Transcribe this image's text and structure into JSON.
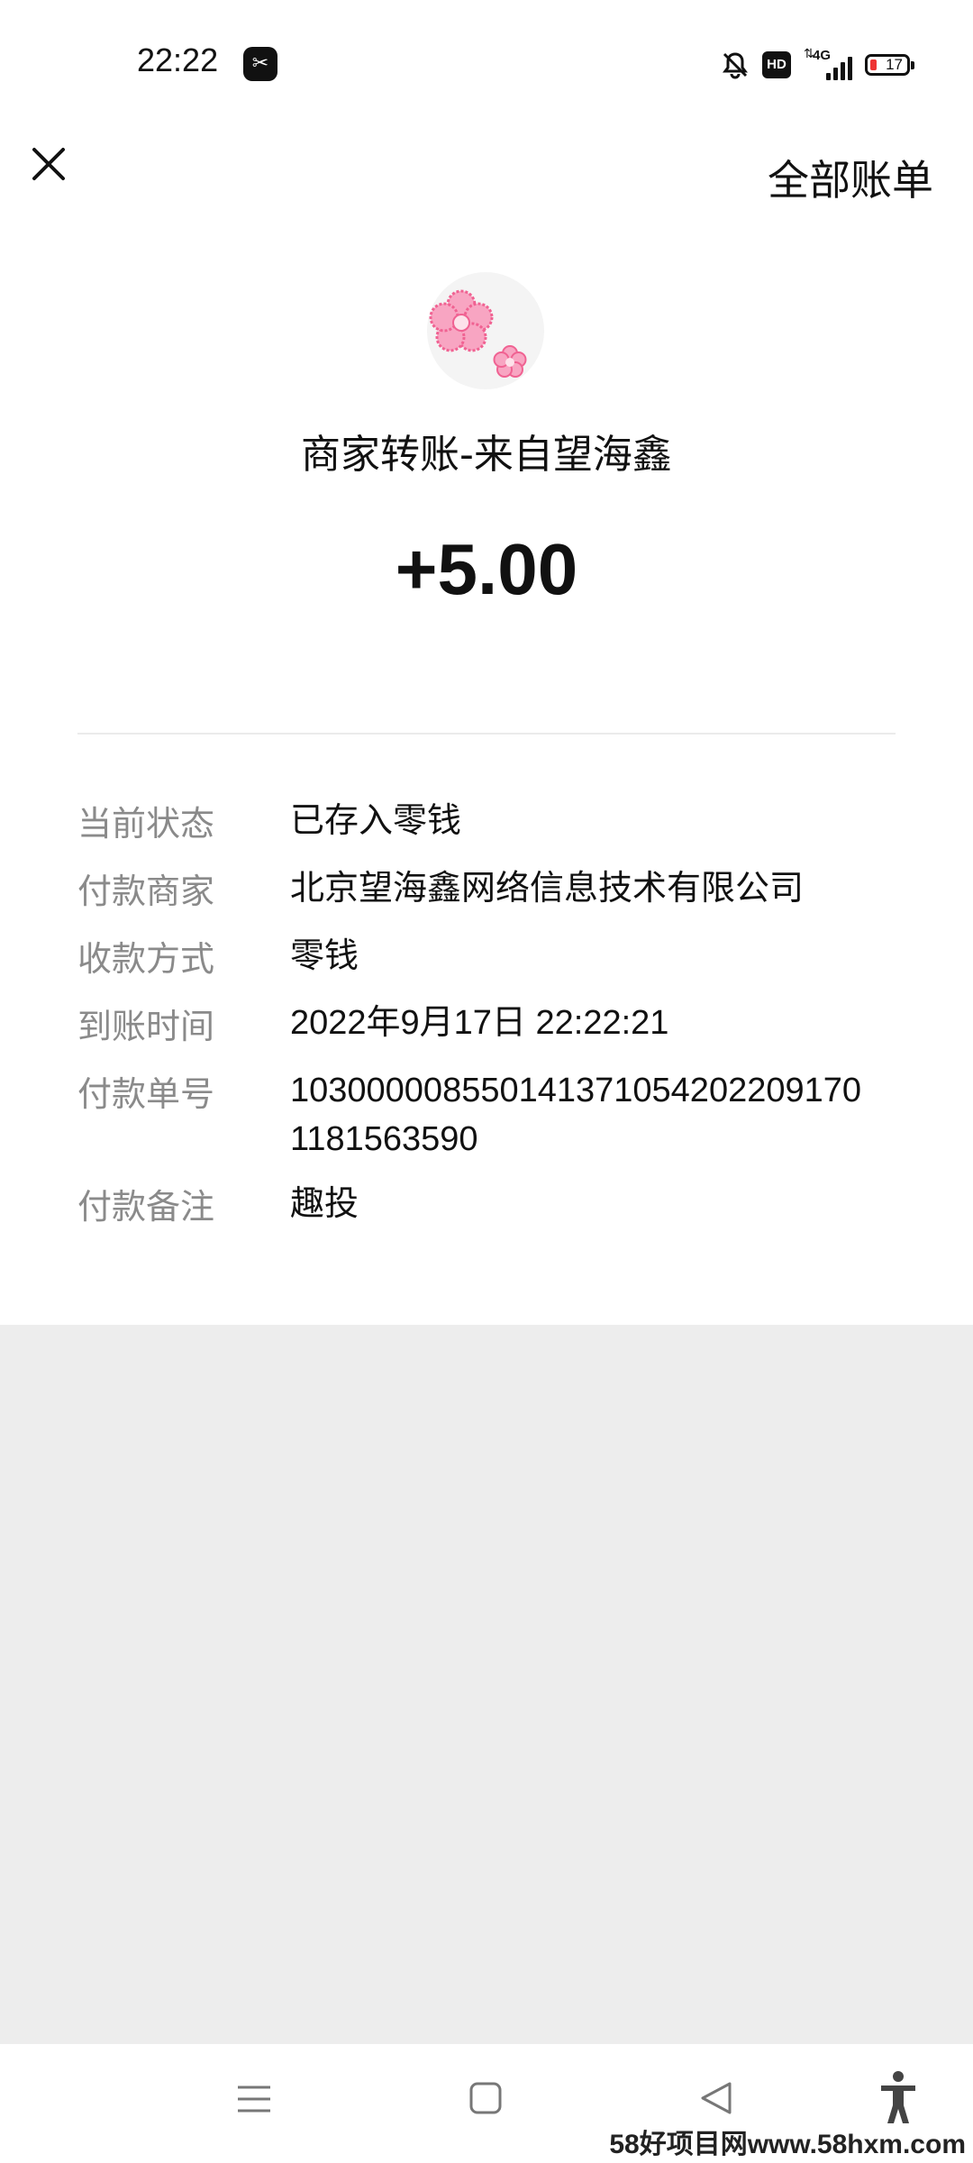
{
  "status_bar": {
    "time": "22:22",
    "network": "4G",
    "hd": "HD",
    "battery": "17"
  },
  "nav": {
    "all_bills_label": "全部账单"
  },
  "transaction": {
    "title": "商家转账-来自望海鑫",
    "amount": "+5.00"
  },
  "details": [
    {
      "label": "当前状态",
      "value": "已存入零钱"
    },
    {
      "label": "付款商家",
      "value": "北京望海鑫网络信息技术有限公司"
    },
    {
      "label": "收款方式",
      "value": "零钱"
    },
    {
      "label": "到账时间",
      "value": "2022年9月17日 22:22:21"
    },
    {
      "label": "付款单号",
      "value": "103000008550141371054202209170 1181563590"
    },
    {
      "label": "付款备注",
      "value": "趣投"
    }
  ],
  "watermark": "58好项目网www.58hxm.com",
  "colors": {
    "background": "#ededed",
    "card": "#ffffff",
    "label": "#8a8a8a",
    "text": "#111111",
    "flower": "#f48fb1"
  }
}
